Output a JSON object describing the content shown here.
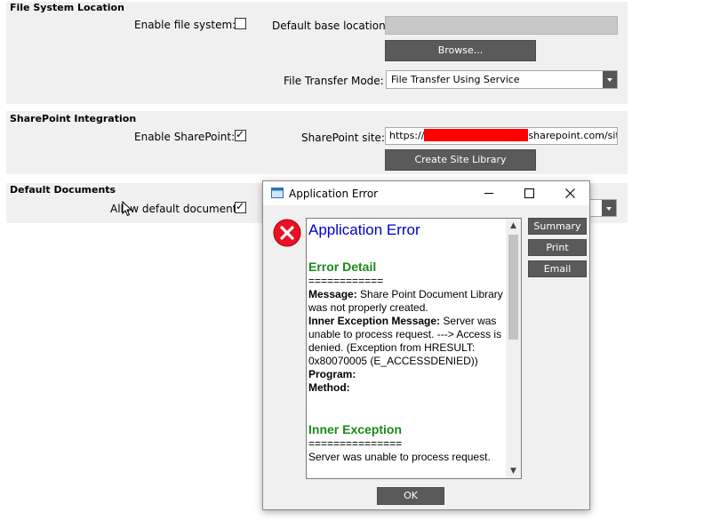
{
  "fs": {
    "title": "File System Location",
    "enable_label": "Enable file system:",
    "enable_checked": false,
    "base_label": "Default base location:",
    "base_value": "",
    "browse": "Browse...",
    "mode_label": "File Transfer Mode:",
    "mode_value": "File Transfer Using Service"
  },
  "sp": {
    "title": "SharePoint Integration",
    "enable_label": "Enable SharePoint:",
    "enable_checked": true,
    "site_label": "SharePoint site:",
    "site_prefix": "https://",
    "site_suffix": "sharepoint.com/sites/",
    "create_button": "Create Site Library"
  },
  "docs": {
    "title": "Default Documents",
    "allow_label": "Allow default document:",
    "allow_checked": true
  },
  "dialog": {
    "title": "Application Error",
    "heading": "Application Error",
    "detail_heading": "Error Detail",
    "sep1": "============",
    "message_key": "Message:",
    "message_val": "Share Point Document Library was not properly created.",
    "inner_msg_key": "Inner Exception Message:",
    "inner_msg_val": "Server was unable to process request. ---> Access is denied. (Exception from HRESULT: 0x80070005 (E_ACCESSDENIED))",
    "program_key": "Program:",
    "method_key": "Method:",
    "inner_heading": "Inner Exception",
    "sep2": "===============",
    "inner_text": "Server was unable to process request.",
    "buttons": {
      "summary": "Summary",
      "print": "Print",
      "email": "Email",
      "ok": "OK"
    }
  },
  "colors": {
    "button_bg": "#5a5a5a",
    "panel_bg": "#f0f0f0",
    "error_red": "#e81123",
    "heading_blue": "#0000cc",
    "heading_green": "#1a8a1a"
  },
  "icons": {
    "error": "error-x-icon",
    "app": "app-window-icon"
  }
}
